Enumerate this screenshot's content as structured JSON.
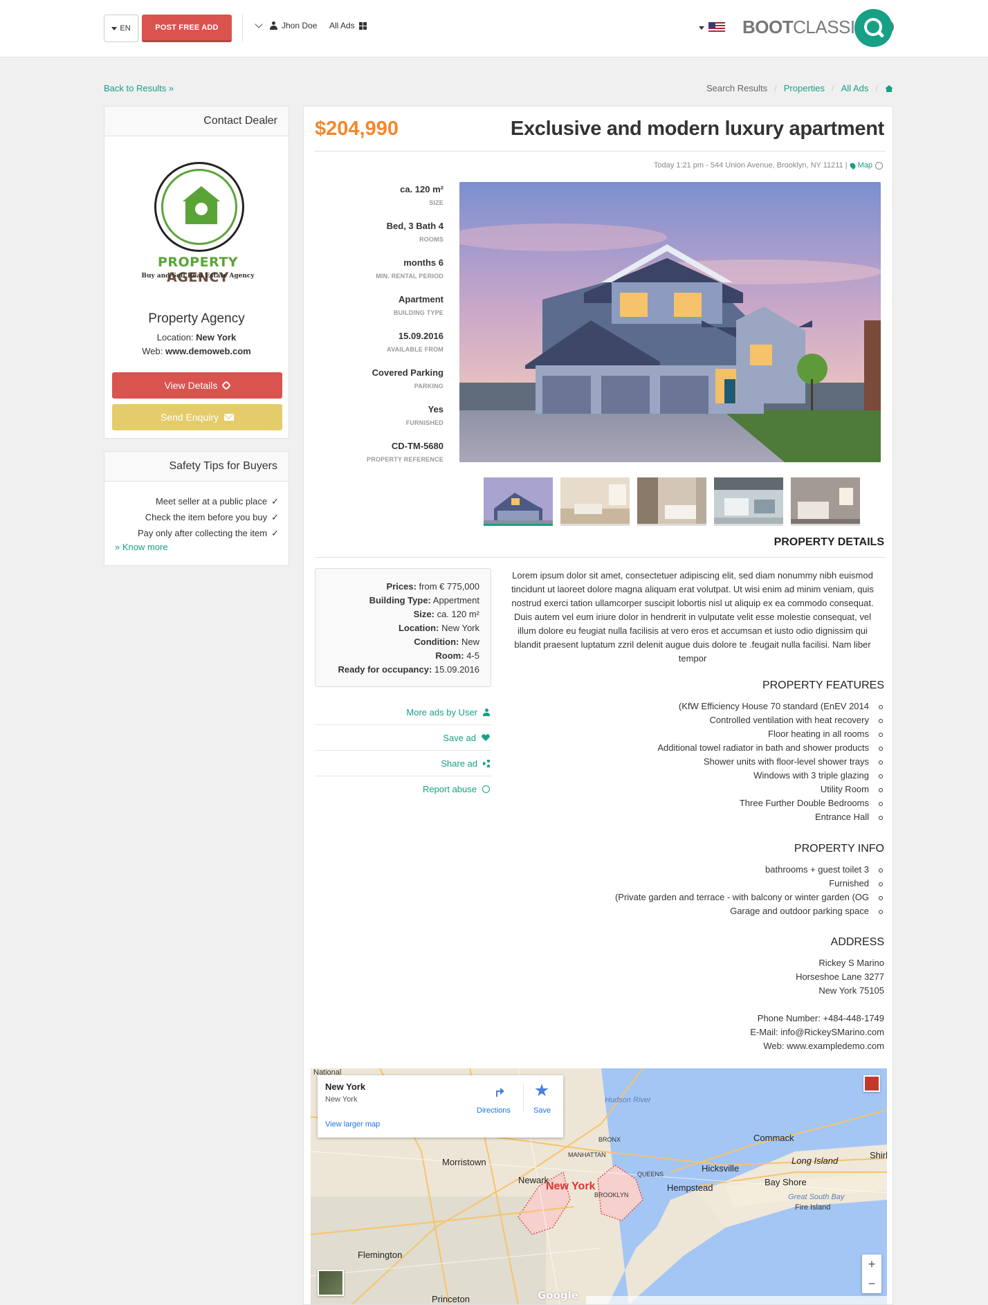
{
  "header": {
    "lang": "EN",
    "post_button": "POST FREE ADD",
    "user": "Jhon Doe",
    "all_ads": "All Ads",
    "brand_bold": "BOOT",
    "brand_rest": "CLASSIFIED"
  },
  "nav": {
    "back": "Back to Results »",
    "breadcrumb": [
      "Search Results",
      "Properties",
      "All Ads"
    ]
  },
  "dealer": {
    "panel_title": "Contact Dealer",
    "logo_title_a": "PROPERTY",
    "logo_title_b": "AGENCY",
    "logo_sub": "Buy and Sell Real Estate Agency",
    "name": "Property Agency",
    "location_label": "Location:",
    "location_value": "New York",
    "web_label": "Web:",
    "web_value": "www.demoweb.com",
    "details_button": "View Details",
    "enquiry_button": "Send Enquiry"
  },
  "safety": {
    "title": "Safety Tips for Buyers",
    "tips": [
      "Meet seller at a public place",
      "Check the item before you buy",
      "Pay only after collecting the item"
    ],
    "know_more": "» Know more"
  },
  "listing": {
    "price": "$204,990",
    "title": "Exclusive and modern luxury apartment",
    "meta_text": "Today 1:21 pm - 544 Union Avenue, Brooklyn, NY 11211 |",
    "meta_map": "Map",
    "specs": [
      {
        "value": "ca. 120 m²",
        "label": "SIZE"
      },
      {
        "value": "Bed, 3 Bath 4",
        "label": "ROOMS"
      },
      {
        "value": "months 6",
        "label": "MIN. RENTAL PERIOD"
      },
      {
        "value": "Apartment",
        "label": "BUILDING TYPE"
      },
      {
        "value": "15.09.2016",
        "label": "AVAILABLE FROM"
      },
      {
        "value": "Covered Parking",
        "label": "PARKING"
      },
      {
        "value": "Yes",
        "label": "FURNISHED"
      },
      {
        "value": "CD-TM-5680",
        "label": "PROPERTY REFERENCE"
      }
    ],
    "details_heading": "PROPERTY DETAILS",
    "details_box": [
      {
        "k": "Prices:",
        "v": "from € 775,000"
      },
      {
        "k": "Building Type:",
        "v": "Appertment"
      },
      {
        "k": "Size:",
        "v": "ca. 120 m²"
      },
      {
        "k": "Location:",
        "v": "New York"
      },
      {
        "k": "Condition:",
        "v": "New"
      },
      {
        "k": "Room:",
        "v": "4-5"
      },
      {
        "k": "Ready for occupancy:",
        "v": "15.09.2016"
      }
    ],
    "description": "Lorem ipsum dolor sit amet, consectetuer adipiscing elit, sed diam nonummy nibh euismod tincidunt ut laoreet dolore magna aliquam erat volutpat. Ut wisi enim ad minim veniam, quis nostrud exerci tation ullamcorper suscipit lobortis nisl ut aliquip ex ea commodo consequat. Duis autem vel eum iriure dolor in hendrerit in vulputate velit esse molestie consequat, vel illum dolore eu feugiat nulla facilisis at vero eros et accumsan et iusto odio dignissim qui blandit praesent luptatum zzril delenit augue duis dolore te .feugait nulla facilisi. Nam liber tempor",
    "actions": [
      "More ads by User",
      "Save ad",
      "Share ad",
      "Report abuse"
    ],
    "features_heading": "PROPERTY FEATURES",
    "features": [
      "(KfW Efficiency House 70 standard (EnEV 2014",
      "Controlled ventilation with heat recovery",
      "Floor heating in all rooms",
      "Additional towel radiator in bath and shower products",
      "Shower units with floor-level shower trays",
      "Windows with 3 triple glazing",
      "Utility Room",
      "Three Further Double Bedrooms",
      "Entrance Hall"
    ],
    "info_heading": "PROPERTY INFO",
    "info": [
      "bathrooms + guest toilet 3",
      "Furnished",
      "(Private garden and terrace - with balcony or winter garden (OG",
      "Garage and outdoor parking space"
    ],
    "address_heading": "ADDRESS",
    "address": [
      "Rickey S Marino",
      "Horseshoe Lane 3277",
      "New York 75105"
    ],
    "contact": [
      "Phone Number: +484-448-1749",
      "E-Mail: info@RickeySMarino.com",
      "Web: www.exampledemo.com"
    ]
  },
  "map": {
    "place": "New York",
    "place_sub": "New York",
    "directions": "Directions",
    "save": "Save",
    "larger": "View larger map",
    "zoom_in": "+",
    "zoom_out": "−",
    "labels": [
      "National",
      "Morristown",
      "Newark",
      "New York",
      "Hempstead",
      "Hicksville",
      "Commack",
      "Long Island",
      "Bay Shore",
      "Fire Island",
      "Flemington",
      "Princeton",
      "Shirley",
      "Great South Bay",
      "Hudson River",
      "BRONX",
      "MANHATTAN",
      "QUEENS",
      "BROOKLYN"
    ],
    "google": "Google"
  }
}
